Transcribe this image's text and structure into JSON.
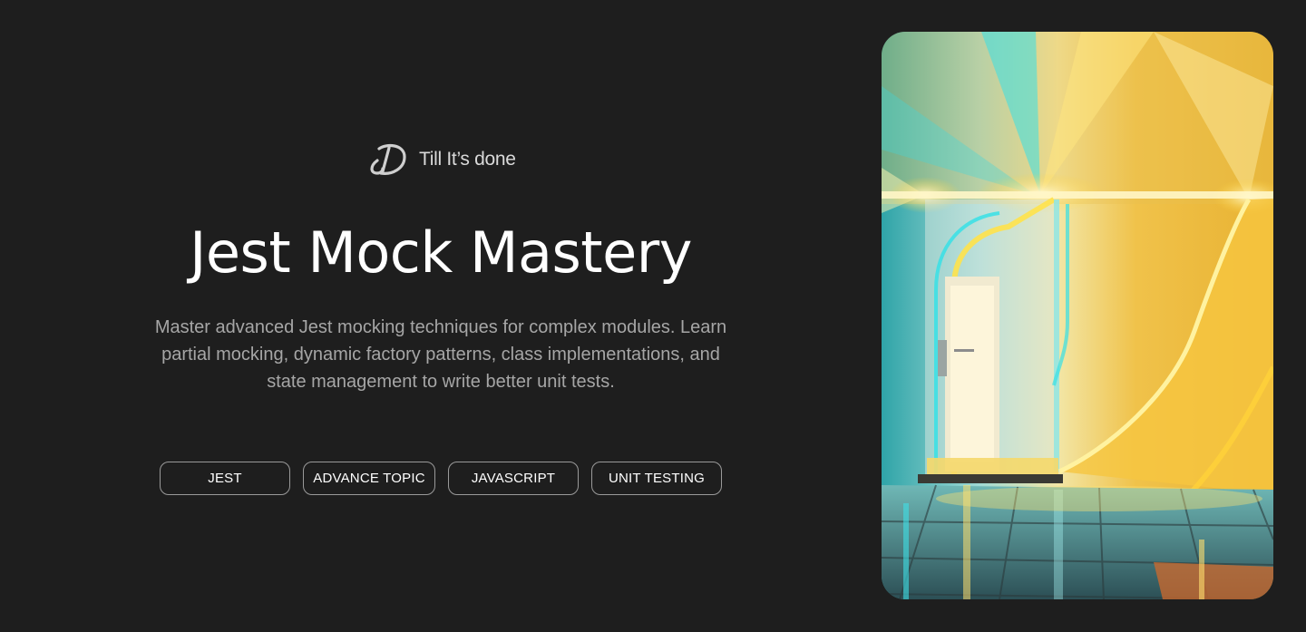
{
  "brand": {
    "name": "Till It’s done",
    "logo_icon": "td-monogram-icon"
  },
  "hero": {
    "title": "Jest Mock Mastery",
    "description": "Master advanced Jest mocking techniques for complex modules. Learn partial mocking, dynamic factory patterns, class implementations, and state management to write better unit tests.",
    "tags": [
      "JEST",
      "ADVANCE TOPIC",
      "JAVASCRIPT",
      "UNIT TESTING"
    ]
  },
  "colors": {
    "background": "#1e1e1e",
    "title": "#ffffff",
    "description": "#a6a6a6",
    "tag_border": "#9a9a9a",
    "accent_yellow": "#f5c518",
    "accent_cyan": "#2ad1d8"
  }
}
